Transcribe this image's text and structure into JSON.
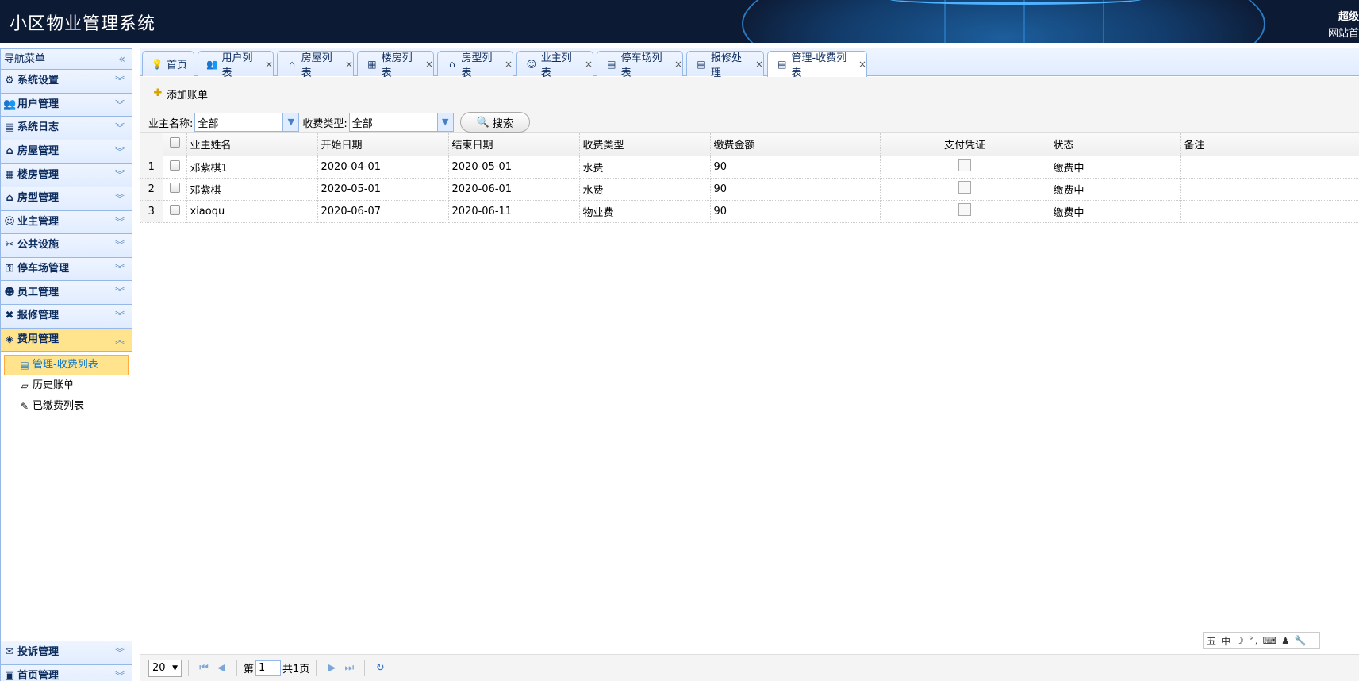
{
  "header": {
    "title": "小区物业管理系统",
    "user": "超级",
    "home_link": "网站首"
  },
  "sidebar": {
    "title": "导航菜单",
    "groups": [
      {
        "label": "系统设置",
        "icon": "gear-icon"
      },
      {
        "label": "用户管理",
        "icon": "users-icon"
      },
      {
        "label": "系统日志",
        "icon": "log-icon"
      },
      {
        "label": "房屋管理",
        "icon": "house-icon"
      },
      {
        "label": "楼房管理",
        "icon": "building-icon"
      },
      {
        "label": "房型管理",
        "icon": "house-type-icon"
      },
      {
        "label": "业主管理",
        "icon": "owner-icon"
      },
      {
        "label": "公共设施",
        "icon": "tools-icon"
      },
      {
        "label": "停车场管理",
        "icon": "parking-icon"
      },
      {
        "label": "员工管理",
        "icon": "staff-icon"
      },
      {
        "label": "报修管理",
        "icon": "repair-icon"
      },
      {
        "label": "费用管理",
        "icon": "money-icon"
      }
    ],
    "sub_items": [
      {
        "label": "管理-收费列表",
        "icon": "table-icon"
      },
      {
        "label": "历史账单",
        "icon": "folder-icon"
      },
      {
        "label": "已缴费列表",
        "icon": "edit-icon"
      }
    ],
    "bottom_groups": [
      {
        "label": "投诉管理",
        "icon": "complaint-icon"
      },
      {
        "label": "首页管理",
        "icon": "homepage-icon"
      }
    ]
  },
  "tabs": [
    {
      "label": "首页",
      "icon": "bulb-icon",
      "closable": false
    },
    {
      "label": "用户列表",
      "icon": "users-icon",
      "closable": true
    },
    {
      "label": "房屋列表",
      "icon": "house-icon",
      "closable": true
    },
    {
      "label": "楼房列表",
      "icon": "building-icon",
      "closable": true
    },
    {
      "label": "房型列表",
      "icon": "house-type-icon",
      "closable": true
    },
    {
      "label": "业主列表",
      "icon": "owner-icon",
      "closable": true
    },
    {
      "label": "停车场列表",
      "icon": "table-icon",
      "closable": true
    },
    {
      "label": "报修处理",
      "icon": "table-icon",
      "closable": true
    },
    {
      "label": "管理-收费列表",
      "icon": "table-icon",
      "closable": true
    }
  ],
  "toolbar": {
    "add_label": "添加账单",
    "owner_label": "业主名称:",
    "owner_value": "全部",
    "type_label": "收费类型:",
    "type_value": "全部",
    "search_label": "搜索"
  },
  "grid": {
    "columns": [
      "业主姓名",
      "开始日期",
      "结束日期",
      "收费类型",
      "缴费金额",
      "支付凭证",
      "状态",
      "备注"
    ],
    "rows": [
      {
        "num": "1",
        "name": "邓紫棋1",
        "start": "2020-04-01",
        "end": "2020-05-01",
        "type": "水费",
        "amount": "90",
        "status": "缴费中",
        "note": ""
      },
      {
        "num": "2",
        "name": "邓紫棋",
        "start": "2020-05-01",
        "end": "2020-06-01",
        "type": "水费",
        "amount": "90",
        "status": "缴费中",
        "note": ""
      },
      {
        "num": "3",
        "name": "xiaoqu",
        "start": "2020-06-07",
        "end": "2020-06-11",
        "type": "物业费",
        "amount": "90",
        "status": "缴费中",
        "note": ""
      }
    ]
  },
  "pager": {
    "page_size": "20",
    "page_prefix": "第",
    "page_number": "1",
    "page_total": "共1页"
  },
  "ime": {
    "chars": [
      "五",
      "中",
      "☽",
      "°,",
      "⌨",
      "♟",
      "🔧"
    ]
  }
}
